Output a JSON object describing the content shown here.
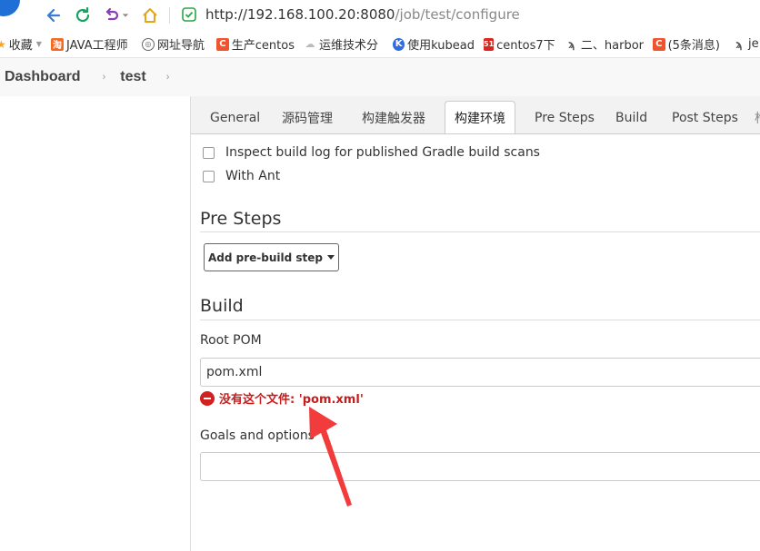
{
  "browser": {
    "url_host": "http://192.168.100.20:8080",
    "url_path": "/job/test/configure",
    "colors": {
      "reload": "#1aa260",
      "back": "#3a7bd5",
      "undo": "#8b3fb5",
      "home": "#e8a317",
      "shield": "#28a745"
    }
  },
  "bookmarks": [
    {
      "label": "收藏",
      "icon": "star-icon",
      "color": "#f5a623"
    },
    {
      "label": "JAVA工程师",
      "icon": "taobao-icon",
      "color": "#f26a24"
    },
    {
      "label": "网址导航",
      "icon": "globe-icon",
      "color": "#666666"
    },
    {
      "label": "生产centos",
      "icon": "csdn-icon",
      "color": "#f0542d"
    },
    {
      "label": "运维技术分",
      "icon": "cloud-icon",
      "color": "#bbbbbb"
    },
    {
      "label": "使用kubead",
      "icon": "k-icon",
      "color": "#326ce5"
    },
    {
      "label": "centos7下",
      "icon": "51cto-icon",
      "color": "#d9251c"
    },
    {
      "label": "二、harbor",
      "icon": "stroke-icon",
      "color": "#555555"
    },
    {
      "label": "(5条消息)",
      "icon": "csdn-icon",
      "color": "#f0542d"
    },
    {
      "label": "je",
      "icon": "stroke-icon",
      "color": "#555555"
    }
  ],
  "breadcrumb": {
    "dashboard": "Dashboard",
    "job": "test"
  },
  "tabs": [
    "General",
    "源码管理",
    "构建触发器",
    "构建环境",
    "Pre Steps",
    "Build",
    "Post Steps",
    "构"
  ],
  "active_tab_index": 3,
  "build_env": {
    "options": [
      {
        "label": "Inspect build log for published Gradle build scans",
        "checked": false
      },
      {
        "label": "With Ant",
        "checked": false
      }
    ]
  },
  "pre_steps": {
    "title": "Pre Steps",
    "add_button": "Add pre-build step"
  },
  "build": {
    "title": "Build",
    "root_pom_label": "Root POM",
    "root_pom_value": "pom.xml",
    "error_message": "没有这个文件: 'pom.xml'",
    "goals_label": "Goals and options",
    "goals_value": ""
  }
}
